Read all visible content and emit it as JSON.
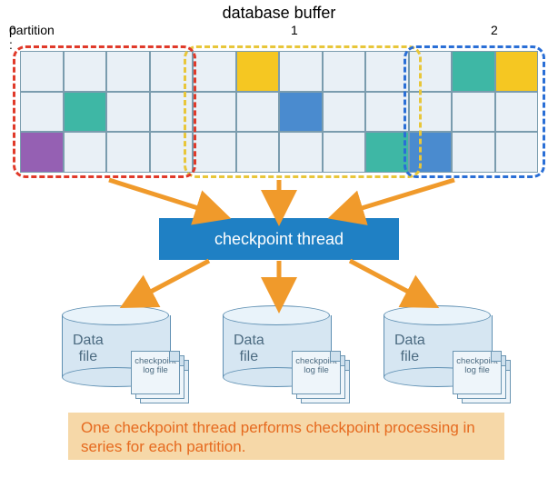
{
  "title": "database buffer",
  "partition_prefix": "partition : ",
  "partitions": [
    "0",
    "1",
    "2"
  ],
  "partition_colors": {
    "0": "#e03a2a",
    "1": "#e8c63a",
    "2": "#2a6fd6"
  },
  "grid": {
    "rows": 3,
    "cols": 12,
    "colored_cells": [
      {
        "row": 0,
        "col": 5,
        "color": "yellow"
      },
      {
        "row": 0,
        "col": 10,
        "color": "teal"
      },
      {
        "row": 0,
        "col": 11,
        "color": "yellow"
      },
      {
        "row": 1,
        "col": 1,
        "color": "teal"
      },
      {
        "row": 1,
        "col": 6,
        "color": "blue"
      },
      {
        "row": 2,
        "col": 0,
        "color": "purple"
      },
      {
        "row": 2,
        "col": 8,
        "color": "teal"
      },
      {
        "row": 2,
        "col": 9,
        "color": "blue"
      }
    ]
  },
  "checkpoint_label": "checkpoint thread",
  "cylinder": {
    "data_label": "Data\nfile",
    "log_label": "checkpoint\nlog file"
  },
  "caption": "One checkpoint thread performs checkpoint processing in series for each partition."
}
